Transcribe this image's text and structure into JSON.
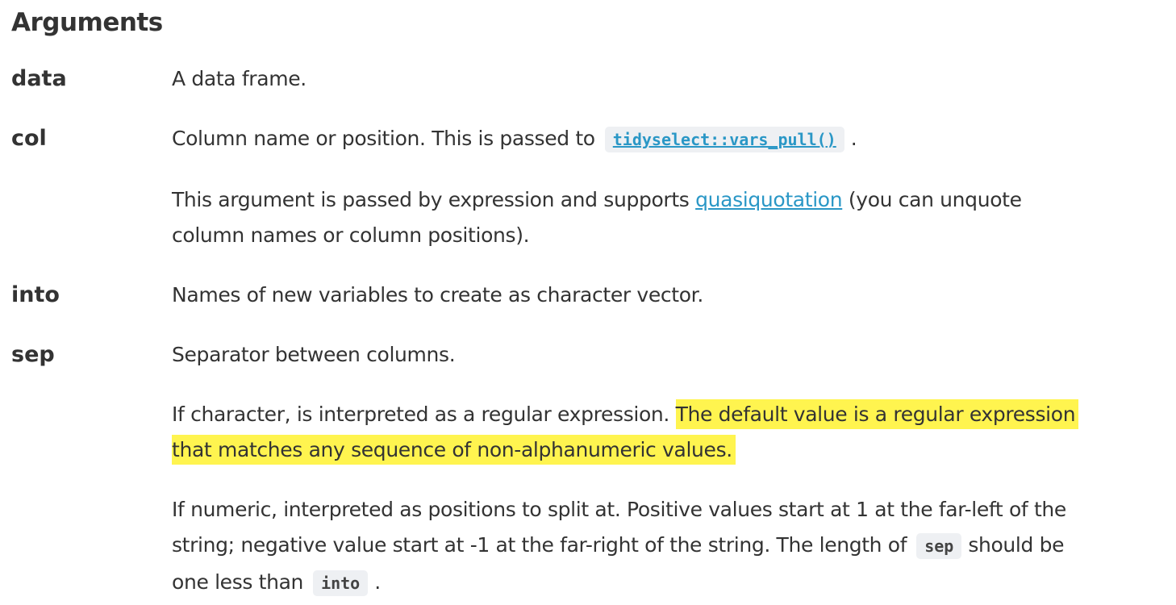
{
  "heading": "Arguments",
  "args": {
    "data": {
      "name": "data",
      "p1": "A data frame."
    },
    "col": {
      "name": "col",
      "p1_before": "Column name or position. This is passed to",
      "p1_code": "tidyselect::vars_pull()",
      "p1_after": ".",
      "p2_before": "This argument is passed by expression and supports",
      "p2_link": "quasiquotation",
      "p2_after_line1": "(you can unquote",
      "p2_line2": "column names or column positions)."
    },
    "into": {
      "name": "into",
      "p1": "Names of new variables to create as character vector."
    },
    "sep": {
      "name": "sep",
      "p1": "Separator between columns.",
      "p2_plain": "If character, is interpreted as a regular expression.",
      "p2_highlight_line1": "The default value is a regular expression",
      "p2_highlight_line2": "that matches any sequence of non-alphanumeric values.",
      "p3_line1": "If numeric, interpreted as positions to split at. Positive values start at 1 at the far-left of the",
      "p3_line2_before": "string; negative value start at -1 at the far-right of the string. The length of",
      "p3_code1": "sep",
      "p3_line2_after": "should be",
      "p3_line3_before": "one less than",
      "p3_code2": "into",
      "p3_line3_after": "."
    }
  },
  "colors": {
    "text": "#333333",
    "link": "#2a97c6",
    "highlight": "#fff44f",
    "code_bg": "#eef0f3"
  }
}
